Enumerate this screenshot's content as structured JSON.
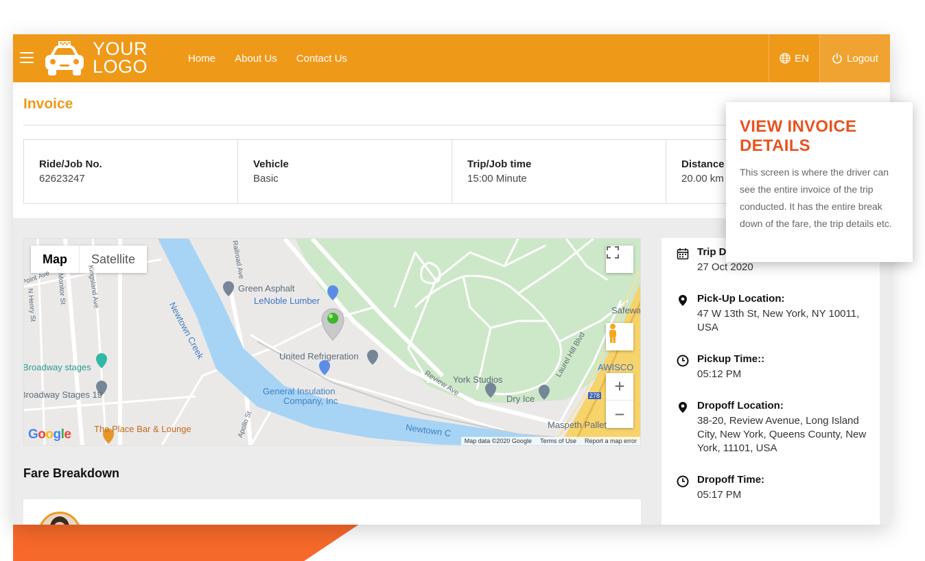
{
  "header": {
    "logo_line1": "YOUR",
    "logo_line2": "LOGO",
    "nav": [
      "Home",
      "About Us",
      "Contact Us"
    ],
    "language": "EN",
    "logout_label": "Logout",
    "brand_color": "#ef9919"
  },
  "page": {
    "title": "Invoice"
  },
  "info": [
    {
      "label": "Ride/Job No.",
      "value": "62623247"
    },
    {
      "label": "Vehicle",
      "value": "Basic"
    },
    {
      "label": "Trip/Job time",
      "value": "15:00 Minute"
    },
    {
      "label": "Distance",
      "value": "20.00 km"
    }
  ],
  "map": {
    "toggle_map": "Map",
    "toggle_satellite": "Satellite",
    "labels": {
      "green_asphalt": "Green Asphalt",
      "lenoble": "LeNoble Lumber",
      "united_ref": "United Refrigeration",
      "general_ins_1": "General Insulation",
      "general_ins_2": "Company, Inc",
      "york_studios": "York Studios",
      "dry_ice": "Dry Ice",
      "broadway_stages": "Broadway stages",
      "broadway_19": "Broadway Stages 19",
      "place_bar": "The Place Bar & Lounge",
      "maspeth": "Maspeth Pallet",
      "awisco": "AWISCO",
      "safeway": "Safeway",
      "newtown_creek": "Newtown Creek",
      "newtown_2": "Newtown C",
      "review_ave": "Review Ave",
      "laurel_hill": "Laurel Hill Blvd",
      "apollo": "Apollo St",
      "railroad": "Railroad Ave",
      "n_henry": "N Henry St",
      "monitor": "Monitor St",
      "kingsland": "Kingsland Ave",
      "point_ave": "Point Ave",
      "route": "278"
    },
    "footer": {
      "data": "Map data ©2020 Google",
      "terms": "Terms of Use",
      "report": "Report a map error"
    },
    "google": "Google"
  },
  "fare": {
    "title": "Fare Breakdown"
  },
  "trip": {
    "date_label": "Trip Date",
    "date_value": "27 Oct 2020",
    "pickup_label": "Pick-Up Location:",
    "pickup_value": "47 W 13th St, New York, NY 10011, USA",
    "pickup_time_label": "Pickup Time::",
    "pickup_time_value": "05:12 PM",
    "dropoff_label": "Dropoff Location:",
    "dropoff_value": "38-20, Review Avenue, Long Island City, New York, Queens County, New York, 11101, USA",
    "dropoff_time_label": "Dropoff Time:",
    "dropoff_time_value": "05:17 PM"
  },
  "popup": {
    "title": "VIEW INVOICE DETAILS",
    "body": "This screen is where the driver can see the entire invoice of the trip conducted. It has the entire break down of the fare, the trip details etc."
  }
}
